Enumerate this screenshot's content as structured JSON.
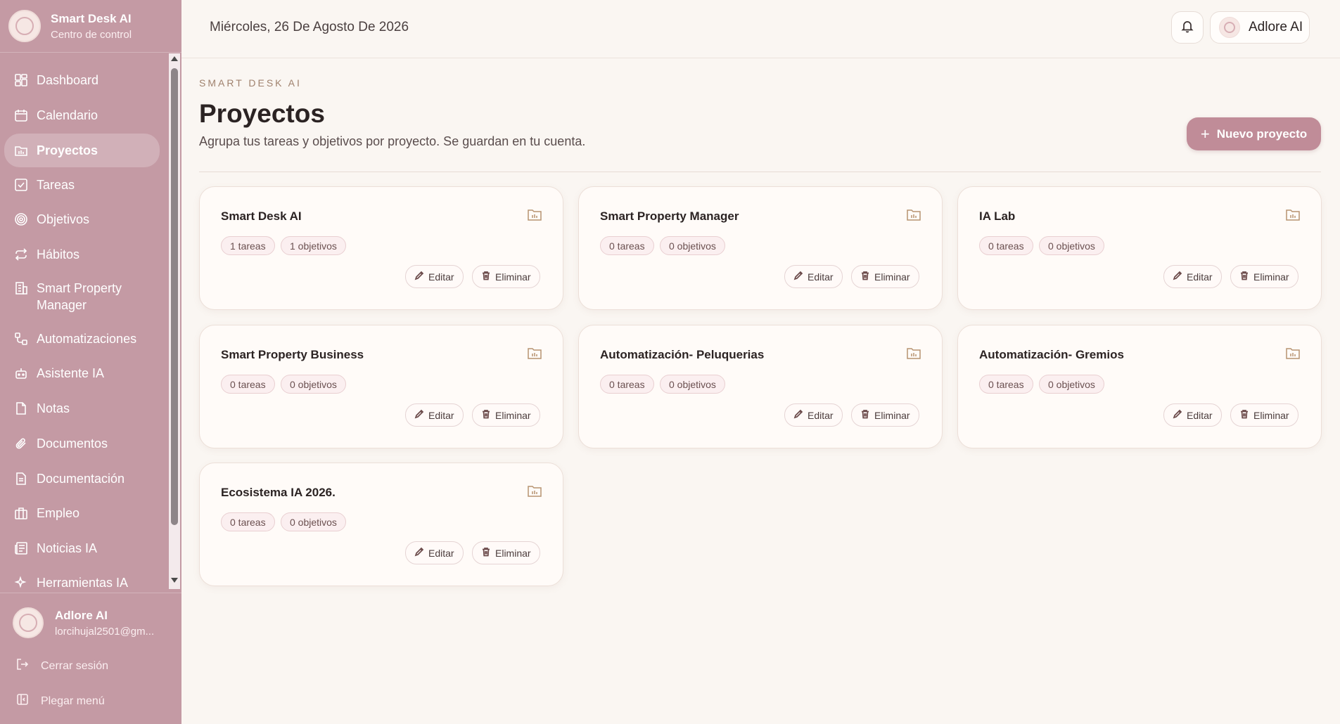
{
  "app": {
    "name": "Smart Desk AI",
    "subtitle": "Centro de control"
  },
  "sidebar": {
    "items": [
      {
        "label": "Dashboard",
        "icon": "dashboard-icon"
      },
      {
        "label": "Calendario",
        "icon": "calendar-icon"
      },
      {
        "label": "Proyectos",
        "icon": "folder-icon",
        "active": true
      },
      {
        "label": "Tareas",
        "icon": "checkbox-icon"
      },
      {
        "label": "Objetivos",
        "icon": "target-icon"
      },
      {
        "label": "Hábitos",
        "icon": "repeat-icon"
      },
      {
        "label": "Smart Property Manager",
        "icon": "building-icon"
      },
      {
        "label": "Automatizaciones",
        "icon": "workflow-icon"
      },
      {
        "label": "Asistente IA",
        "icon": "bot-icon"
      },
      {
        "label": "Notas",
        "icon": "note-icon"
      },
      {
        "label": "Documentos",
        "icon": "paperclip-icon"
      },
      {
        "label": "Documentación",
        "icon": "document-icon"
      },
      {
        "label": "Empleo",
        "icon": "briefcase-icon"
      },
      {
        "label": "Noticias IA",
        "icon": "newspaper-icon"
      },
      {
        "label": "Herramientas IA",
        "icon": "sparkles-icon"
      }
    ],
    "user": {
      "name": "Adlore AI",
      "email": "lorcihujal2501@gm..."
    },
    "logout_label": "Cerrar sesión",
    "collapse_label": "Plegar menú"
  },
  "header": {
    "date": "Miércoles, 26 De Agosto De 2026",
    "profile_name": "Adlore AI"
  },
  "main": {
    "eyebrow": "SMART DESK AI",
    "title": "Proyectos",
    "subtitle": "Agrupa tus tareas y objetivos por proyecto. Se guardan en tu cuenta.",
    "new_button": "Nuevo proyecto",
    "edit_label": "Editar",
    "delete_label": "Eliminar",
    "projects": [
      {
        "name": "Smart Desk AI",
        "tasks": "1 tareas",
        "goals": "1 objetivos"
      },
      {
        "name": "Smart Property Manager",
        "tasks": "0 tareas",
        "goals": "0 objetivos"
      },
      {
        "name": "IA Lab",
        "tasks": "0 tareas",
        "goals": "0 objetivos"
      },
      {
        "name": "Smart Property Business",
        "tasks": "0 tareas",
        "goals": "0 objetivos"
      },
      {
        "name": "Automatización- Peluquerias",
        "tasks": "0 tareas",
        "goals": "0 objetivos"
      },
      {
        "name": "Automatización- Gremios",
        "tasks": "0 tareas",
        "goals": "0 objetivos"
      },
      {
        "name": "Ecosistema IA 2026.",
        "tasks": "0 tareas",
        "goals": "0 objetivos"
      }
    ]
  },
  "colors": {
    "sidebar": "#c49aa4",
    "accent": "#c08c98",
    "background": "#faf6f2"
  }
}
